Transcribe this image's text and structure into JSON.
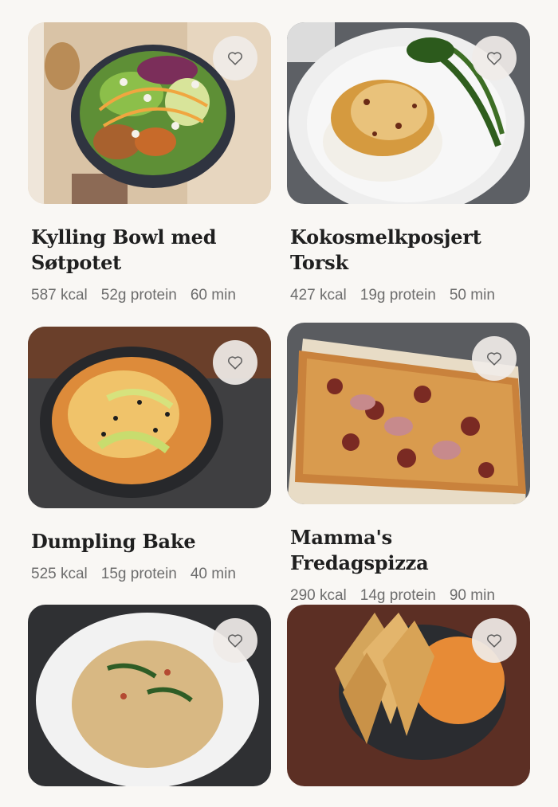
{
  "favorite_icon": "heart-outline-icon",
  "colors": {
    "background": "#f9f7f4",
    "title": "#1f1f1f",
    "meta": "#6d6d6d",
    "favorite_button_bg": "#f0ece8"
  },
  "recipes": [
    {
      "title": "Kylling Bowl med Søtpotet",
      "kcal": "587 kcal",
      "protein": "52g protein",
      "time": "60 min",
      "image": "chicken-bowl-photo"
    },
    {
      "title": "Kokosmelkposjert Torsk",
      "kcal": "427 kcal",
      "protein": "19g protein",
      "time": "50 min",
      "image": "poached-cod-photo"
    },
    {
      "title": "Dumpling Bake",
      "kcal": "525 kcal",
      "protein": "15g protein",
      "time": "40 min",
      "image": "dumpling-bake-photo"
    },
    {
      "title": "Mamma's Fredagspizza",
      "kcal": "290 kcal",
      "protein": "14g protein",
      "time": "90 min",
      "image": "friday-pizza-photo"
    },
    {
      "title": "",
      "kcal": "",
      "protein": "",
      "time": "",
      "image": "orzo-pasta-photo"
    },
    {
      "title": "",
      "kcal": "",
      "protein": "",
      "time": "",
      "image": "bread-soup-photo"
    }
  ]
}
